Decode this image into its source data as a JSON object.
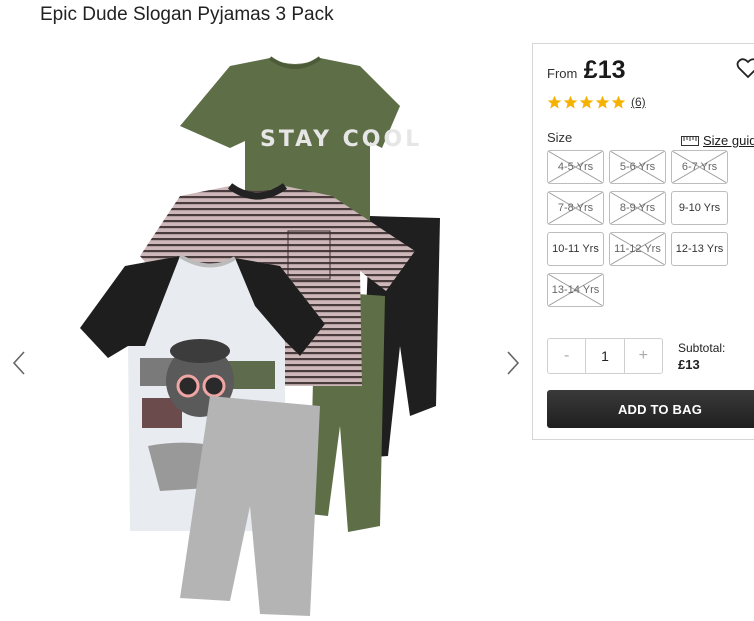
{
  "product": {
    "title": "Epic Dude Slogan Pyjamas 3 Pack"
  },
  "price": {
    "from_label": "From",
    "amount": "£13"
  },
  "rating": {
    "stars": 5,
    "review_count": "(6)"
  },
  "size": {
    "label": "Size",
    "guide_label": "Size guide",
    "options": [
      {
        "label": "4-5 Yrs",
        "available": false
      },
      {
        "label": "5-6 Yrs",
        "available": false
      },
      {
        "label": "6-7 Yrs",
        "available": false
      },
      {
        "label": "7-8 Yrs",
        "available": false
      },
      {
        "label": "8-9 Yrs",
        "available": false
      },
      {
        "label": "9-10 Yrs",
        "available": true
      },
      {
        "label": "10-11 Yrs",
        "available": true
      },
      {
        "label": "11-12 Yrs",
        "available": false
      },
      {
        "label": "12-13 Yrs",
        "available": true
      },
      {
        "label": "13-14 Yrs",
        "available": false
      }
    ]
  },
  "quantity": {
    "minus": "-",
    "value": "1",
    "plus": "+"
  },
  "subtotal": {
    "label": "Subtotal:",
    "value": "£13"
  },
  "cart": {
    "add_label": "ADD TO BAG"
  },
  "image_text": {
    "slogan": "STAY COOL"
  },
  "icons": {
    "prev": "chevron-left-icon",
    "next": "chevron-right-icon",
    "wishlist": "heart-icon",
    "rating": "star-icon",
    "size_guide": "ruler-icon"
  },
  "colors": {
    "star": "#f5b301",
    "button": "#2a2a2a",
    "khaki": "#5e6f47",
    "grey_shorts": "#b4b4b4"
  }
}
